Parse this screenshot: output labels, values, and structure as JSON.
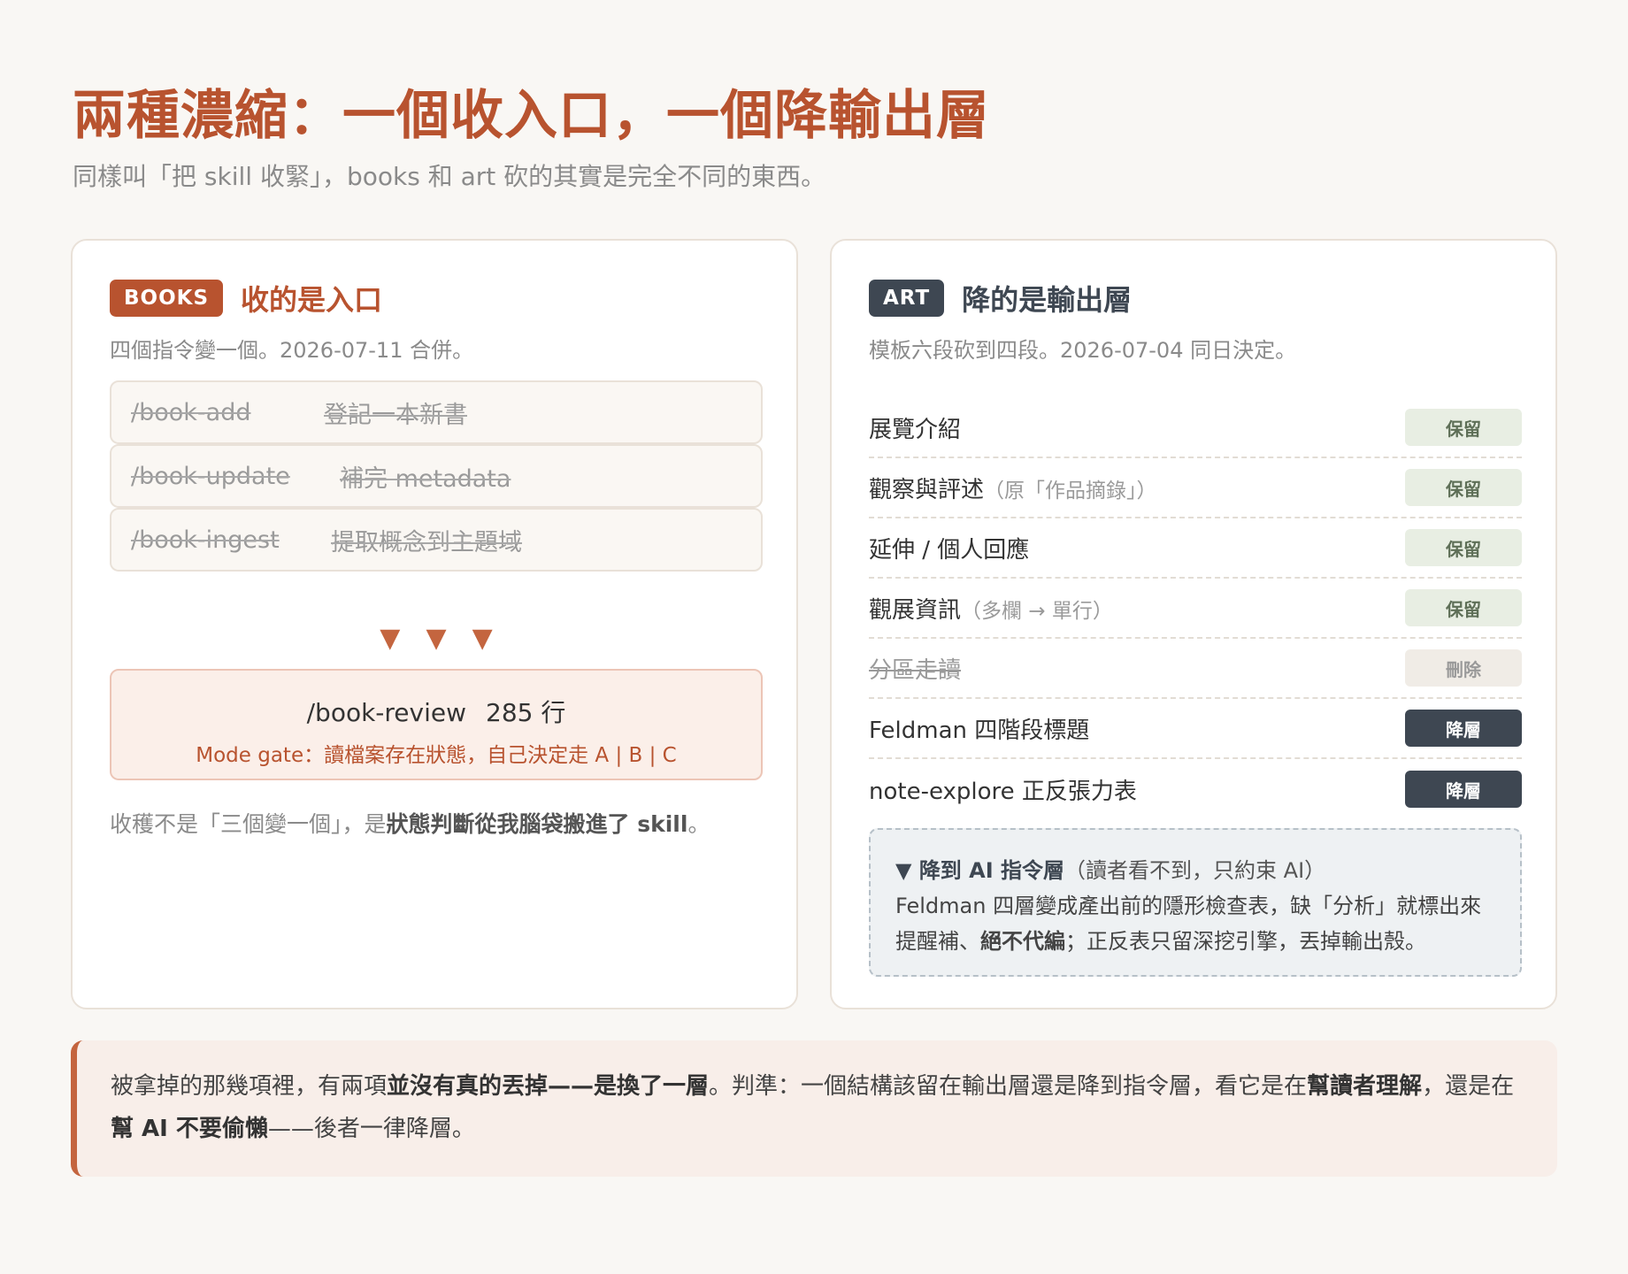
{
  "header": {
    "title": "兩種濃縮：一個收入口，一個降輸出層",
    "subtitle": "同樣叫「把 skill 收緊」，books 和 art 砍的其實是完全不同的東西。"
  },
  "books": {
    "tag": "BOOKS",
    "title": "收的是入口",
    "subtitle": "四個指令變一個。2026-07-11 合併。",
    "commands": [
      {
        "name": "/book-add",
        "desc": "登記一本新書"
      },
      {
        "name": "/book-update",
        "desc": "補完 metadata"
      },
      {
        "name": "/book-ingest",
        "desc": "提取概念到主題域"
      }
    ],
    "arrows": [
      "▼",
      "▼",
      "▼"
    ],
    "review": {
      "name": "/book-review",
      "lines": "285 行",
      "gate": "Mode gate：讀檔案存在狀態，自己決定走 A | B | C"
    },
    "harvest": {
      "prefix": "收穫不是「三個變一個」，是",
      "bold": "狀態判斷從我腦袋搬進了 skill",
      "suffix": "。"
    }
  },
  "art": {
    "tag": "ART",
    "title": "降的是輸出層",
    "subtitle": "模板六段砍到四段。2026-07-04 同日決定。",
    "rows": [
      {
        "label": "展覽介紹",
        "note": "",
        "badge": "保留",
        "kind": "keep"
      },
      {
        "label": "觀察與評述",
        "note": "（原「作品摘錄」）",
        "badge": "保留",
        "kind": "keep"
      },
      {
        "label": "延伸 / 個人回應",
        "note": "",
        "badge": "保留",
        "kind": "keep"
      },
      {
        "label": "觀展資訊",
        "note": "（多欄 → 單行）",
        "badge": "保留",
        "kind": "keep"
      },
      {
        "label": "分區走讀",
        "note": "",
        "badge": "刪除",
        "kind": "del"
      },
      {
        "label": "Feldman 四階段標題",
        "note": "",
        "badge": "降層",
        "kind": "down"
      },
      {
        "label": "note-explore 正反張力表",
        "note": "",
        "badge": "降層",
        "kind": "down"
      }
    ],
    "ai_box": {
      "head_bold": "▼ 降到 AI 指令層",
      "head_paren": "（讀者看不到，只約束 AI）",
      "body_1": "Feldman 四層變成產出前的隱形檢查表，缺「分析」就標出來提醒補、",
      "body_bold": "絕不代編",
      "body_2": "；正反表只留深挖引擎，丟掉輸出殼。"
    }
  },
  "footer": {
    "p1": "被拿掉的那幾項裡，有兩項",
    "b1": "並沒有真的丟掉——是換了一層",
    "p2": "。判準：一個結構該留在輸出層還是降到指令層，看它是在",
    "b2": "幫讀者理解",
    "p3": "，還是在",
    "b3": "幫 AI 不要偷懶",
    "p4": "——後者一律降層。"
  },
  "colors": {
    "accent": "#b8532f",
    "dark": "#3e4752",
    "keep_bg": "#e8eee3",
    "background": "#f9f7f4"
  }
}
